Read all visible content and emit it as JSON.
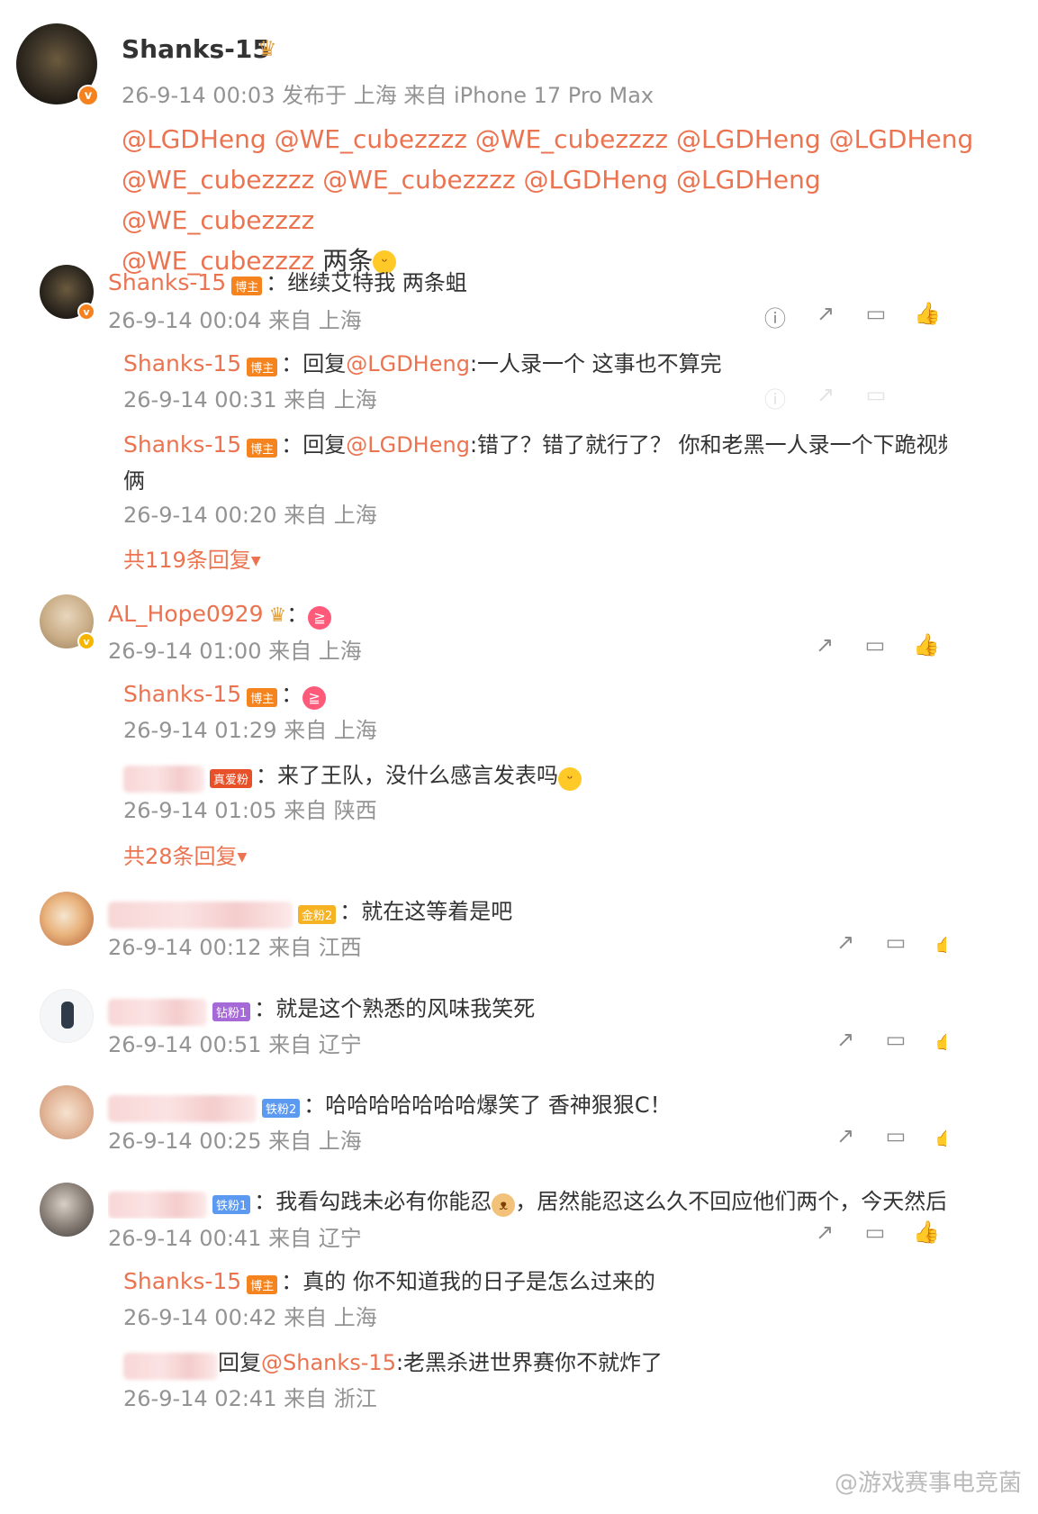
{
  "post": {
    "author": "Shanks-15",
    "meta": "26-9-14 00:03 发布于 上海 来自 iPhone 17 Pro Max",
    "line1": [
      "@LGDHeng",
      "@WE_cubezzzz",
      "@WE_cubezzzz",
      "@LGDHeng",
      "@LGDHeng"
    ],
    "line2": [
      "@WE_cubezzzz",
      "@WE_cubezzzz",
      "@LGDHeng",
      "@LGDHeng",
      "@WE_cubezzzz"
    ],
    "line3_mention": "@WE_cubezzzz",
    "line3_text": "两条"
  },
  "tags": {
    "host": "博主",
    "love": "真爱粉",
    "gold2": "金粉2",
    "drill1": "钻粉1",
    "iron2": "铁粉2",
    "iron1": "铁粉1"
  },
  "comments": {
    "c1": {
      "name": "Shanks-15",
      "text": "继续艾特我 两条蛆",
      "meta": "26-9-14 00:04 来自 上海"
    },
    "c1r1": {
      "name": "Shanks-15",
      "reply_prefix": "回复",
      "mention": "@LGDHeng",
      "text": ":一人录一个 这事也不算完",
      "meta": "26-9-14 00:31 来自 上海"
    },
    "c1r2": {
      "name": "Shanks-15",
      "reply_prefix": "回复",
      "mention": "@LGDHeng",
      "text": ":错了？错了就行了？ 你和老黑一人录一个下跪视频原谅",
      "text2": "俩",
      "meta": "26-9-14 00:20 来自 上海"
    },
    "c1more": "共119条回复",
    "c2": {
      "name": "AL_Hope0929",
      "meta": "26-9-14 01:00 来自 上海"
    },
    "c2r1": {
      "name": "Shanks-15",
      "meta": "26-9-14 01:29 来自 上海"
    },
    "c2r2": {
      "text": "来了王队，没什么感言发表吗",
      "meta": "26-9-14 01:05 来自 陕西"
    },
    "c2more": "共28条回复",
    "c3": {
      "text": "就在这等着是吧",
      "meta": "26-9-14 00:12 来自 江西"
    },
    "c4": {
      "text": "就是这个熟悉的风味我笑死",
      "meta": "26-9-14 00:51 来自 辽宁"
    },
    "c5": {
      "text": "哈哈哈哈哈哈哈爆笑了 香神狠狠C！",
      "meta": "26-9-14 00:25 来自 上海"
    },
    "c6": {
      "text_a": "我看勾践未必有你能忍",
      "text_b": "，居然能忍这么久不回应他们两个，今天然后游",
      "meta": "26-9-14 00:41 来自 辽宁"
    },
    "c6r1": {
      "name": "Shanks-15",
      "text": "真的 你不知道我的日子是怎么过来的",
      "meta": "26-9-14 00:42 来自 上海"
    },
    "c6r2": {
      "reply_prefix": "回复",
      "mention": "@Shanks-15",
      "text": ":老黑杀进世界赛你不就炸了",
      "meta": "26-9-14 02:41 来自 浙江"
    }
  },
  "watermark": "@游戏赛事电竞菌",
  "icons": {
    "report": "report-icon",
    "share": "share-icon",
    "comment": "comment-icon",
    "like": "like-icon"
  },
  "colors": {
    "accent": "#eb7350",
    "meta": "#939393",
    "host_tag": "#f5841f"
  }
}
